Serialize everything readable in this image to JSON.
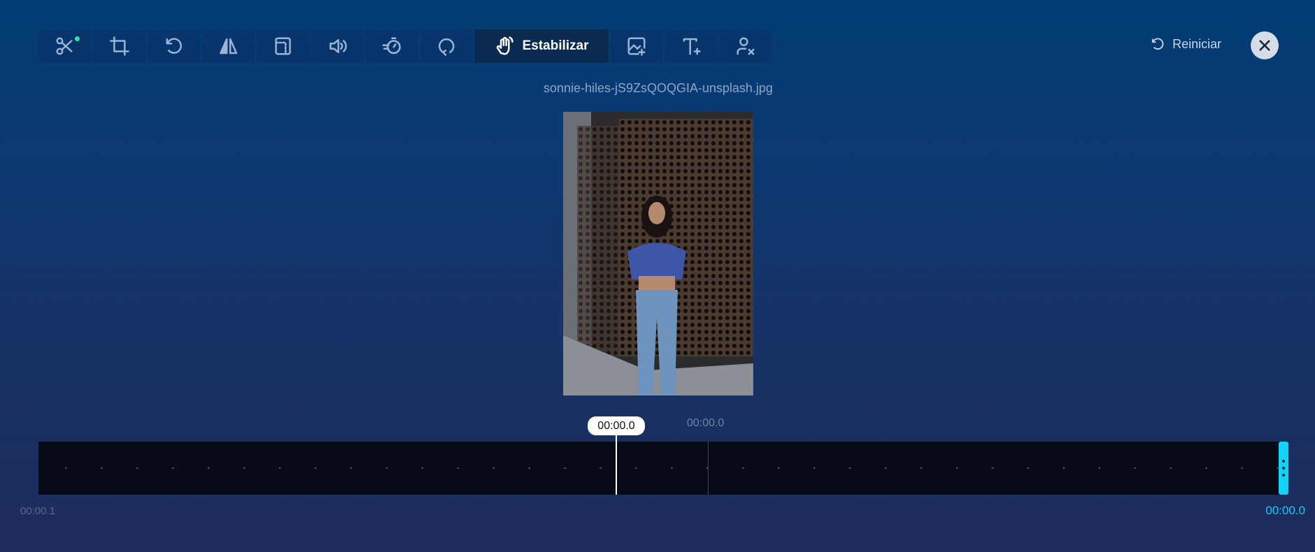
{
  "toolbar": {
    "items": [
      {
        "icon": "scissors-icon",
        "label": "Cortar"
      },
      {
        "icon": "crop-icon"
      },
      {
        "icon": "rotate-icon"
      },
      {
        "icon": "flip-icon"
      },
      {
        "icon": "frame-icon"
      },
      {
        "icon": "volume-icon"
      },
      {
        "icon": "speed-icon"
      },
      {
        "icon": "loop-icon"
      }
    ],
    "active_label": "Estabilizar",
    "after": [
      {
        "icon": "add-image-icon"
      },
      {
        "icon": "add-text-icon"
      },
      {
        "icon": "remove-person-icon"
      }
    ]
  },
  "header": {
    "reset_label": "Reiniciar"
  },
  "file_name": "sonnie-hiles-jS9ZsQOQGIA-unsplash.jpg",
  "timeline": {
    "playhead_time": "00:00.0",
    "marker_time": "00:00.0",
    "start_time": "00:00.1",
    "end_time": "00:00.0"
  },
  "colors": {
    "accent": "#13d3f5",
    "indicator": "#2ee59d"
  }
}
